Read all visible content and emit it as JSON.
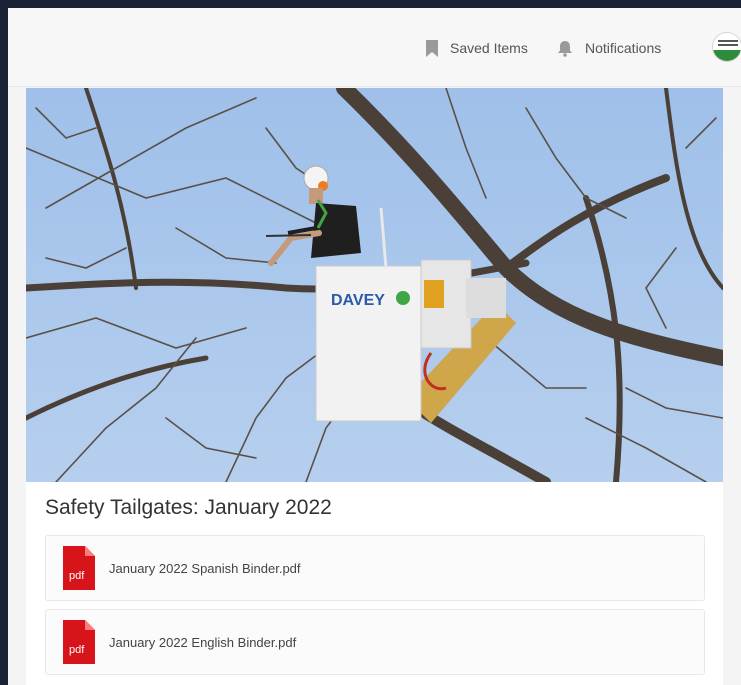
{
  "header": {
    "saved_label": "Saved Items",
    "notifications_label": "Notifications",
    "avatar_icon": "organization-logo-avatar"
  },
  "hero": {
    "truck_logo_text": "DAVEY"
  },
  "content": {
    "title": "Safety Tailgates: January 2022",
    "files": [
      {
        "name": "January 2022 Spanish Binder.pdf",
        "icon": "pdf-file-icon",
        "icon_label": "pdf"
      },
      {
        "name": "January 2022 English Binder.pdf",
        "icon": "pdf-file-icon",
        "icon_label": "pdf"
      }
    ]
  },
  "colors": {
    "page_bg": "#1c2235",
    "pdf_red": "#d8141b",
    "sky": "#a9c6ea",
    "davey_green": "#3fa545"
  }
}
